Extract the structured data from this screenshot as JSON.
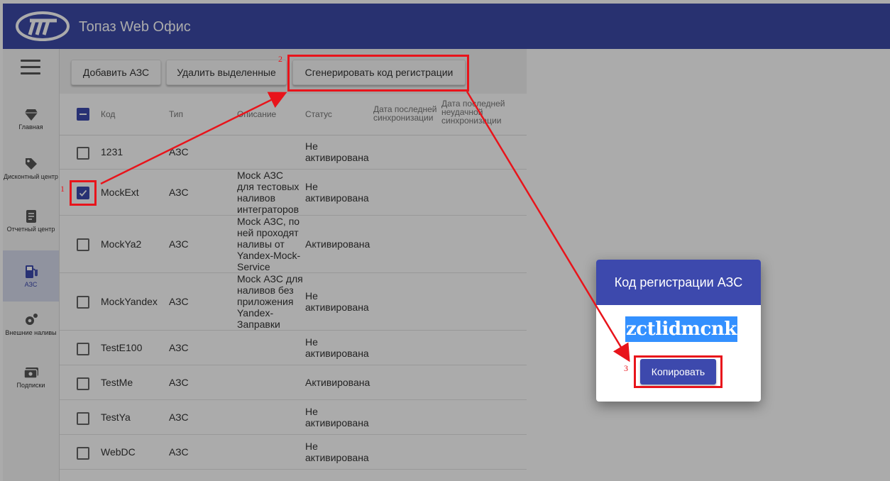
{
  "app": {
    "title": "Топаз Web Офис"
  },
  "sidebar": {
    "items": [
      {
        "label": "Главная",
        "icon": "diamond-icon"
      },
      {
        "label": "Дисконтный центр",
        "icon": "tag-icon"
      },
      {
        "label": "Отчетный центр",
        "icon": "report-icon"
      },
      {
        "label": "АЗС",
        "icon": "fuel-pump-icon",
        "active": true
      },
      {
        "label": "Внешние наливы",
        "icon": "gears-icon"
      },
      {
        "label": "Подписки",
        "icon": "subscription-icon"
      }
    ]
  },
  "toolbar": {
    "add_label": "Добавить АЗС",
    "delete_label": "Удалить выделенные",
    "generate_label": "Сгенерировать код регистрации"
  },
  "table": {
    "columns": [
      "Код",
      "Тип",
      "Описание",
      "Статус",
      "Дата последней синхронизации",
      "Дата последней неудачной синхронизации"
    ],
    "rows": [
      {
        "code": "1231",
        "type": "АЗС",
        "description": "",
        "status": "Не активирована",
        "checked": false
      },
      {
        "code": "MockExt",
        "type": "АЗС",
        "description": "Mock АЗС для тестовых наливов интеграторов",
        "status": "Не активирована",
        "checked": true
      },
      {
        "code": "MockYa2",
        "type": "АЗС",
        "description": "Mock АЗС, по ней проходят наливы от Yandex-Mock-Service",
        "status": "Активирована",
        "checked": false
      },
      {
        "code": "MockYandex",
        "type": "АЗС",
        "description": "Mock АЗС для наливов без приложения Yandex-Заправки",
        "status": "Не активирована",
        "checked": false
      },
      {
        "code": "TestE100",
        "type": "АЗС",
        "description": "",
        "status": "Не активирована",
        "checked": false
      },
      {
        "code": "TestMe",
        "type": "АЗС",
        "description": "",
        "status": "Активирована",
        "checked": false
      },
      {
        "code": "TestYa",
        "type": "АЗС",
        "description": "",
        "status": "Не активирована",
        "checked": false
      },
      {
        "code": "WebDC",
        "type": "АЗС",
        "description": "",
        "status": "Не активирована",
        "checked": false
      }
    ]
  },
  "dialog": {
    "title": "Код регистрации АЗС",
    "code": "zctlidmcnk",
    "copy_label": "Копировать"
  },
  "annotations": {
    "n1": "1",
    "n2": "2",
    "n3": "3"
  },
  "colors": {
    "header": "#3c4aa8",
    "accent": "#3d49ad",
    "annotation": "#e8141b"
  }
}
